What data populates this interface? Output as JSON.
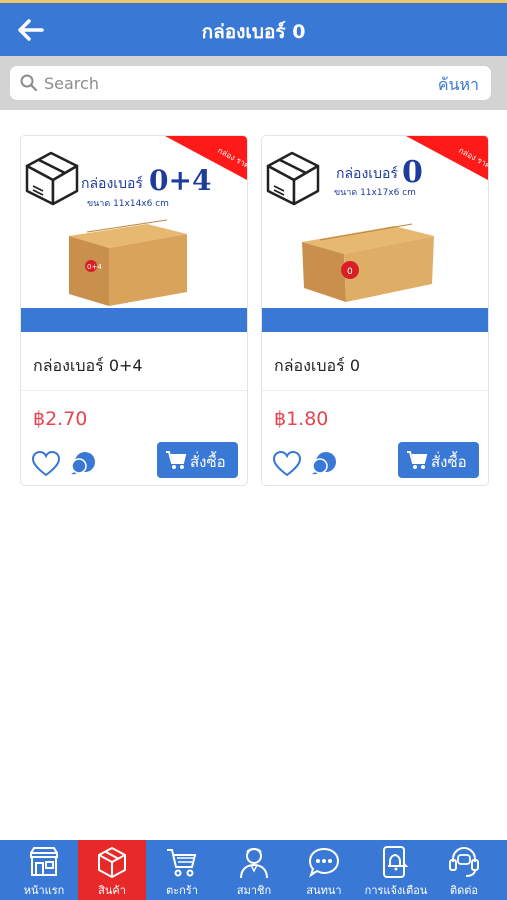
{
  "header": {
    "title": "กล่องเบอร์ 0",
    "back_icon": "arrow-left-icon"
  },
  "search": {
    "placeholder": "Search",
    "button_label": "ค้นหา",
    "icon": "search-icon"
  },
  "colors": {
    "primary": "#3a78d6",
    "price": "#e5454f",
    "active_nav": "#e82929",
    "ribbon": "#ff1a1a",
    "box": "#d9a35c"
  },
  "products": [
    {
      "name": "กล่องเบอร์ 0+4",
      "price": "฿2.70",
      "order_label": "สั่งซื้อ",
      "image": {
        "title": "กล่องเบอร์",
        "number": "0+4",
        "size": "ขนาด 11x14x6 cm",
        "ribbon": "กล่อง ราคาถูก",
        "box_label": "0+4"
      }
    },
    {
      "name": "กล่องเบอร์ 0",
      "price": "฿1.80",
      "order_label": "สั่งซื้อ",
      "image": {
        "title": "กล่องเบอร์",
        "number": "0",
        "size": "ขนาด 11x17x6 cm",
        "ribbon": "กล่อง ราคาถูก",
        "box_label": "0"
      }
    }
  ],
  "nav": [
    {
      "label": "หน้าแรก",
      "icon": "home-store-icon"
    },
    {
      "label": "สินค้า",
      "icon": "box-icon",
      "active": true
    },
    {
      "label": "ตะกร้า",
      "icon": "cart-icon"
    },
    {
      "label": "สมาชิก",
      "icon": "member-icon"
    },
    {
      "label": "สนทนา",
      "icon": "chat-bubble-icon"
    },
    {
      "label": "การแจ้งเตือน",
      "icon": "phone-notification-icon"
    },
    {
      "label": "ติดต่อ",
      "icon": "headset-icon"
    }
  ]
}
